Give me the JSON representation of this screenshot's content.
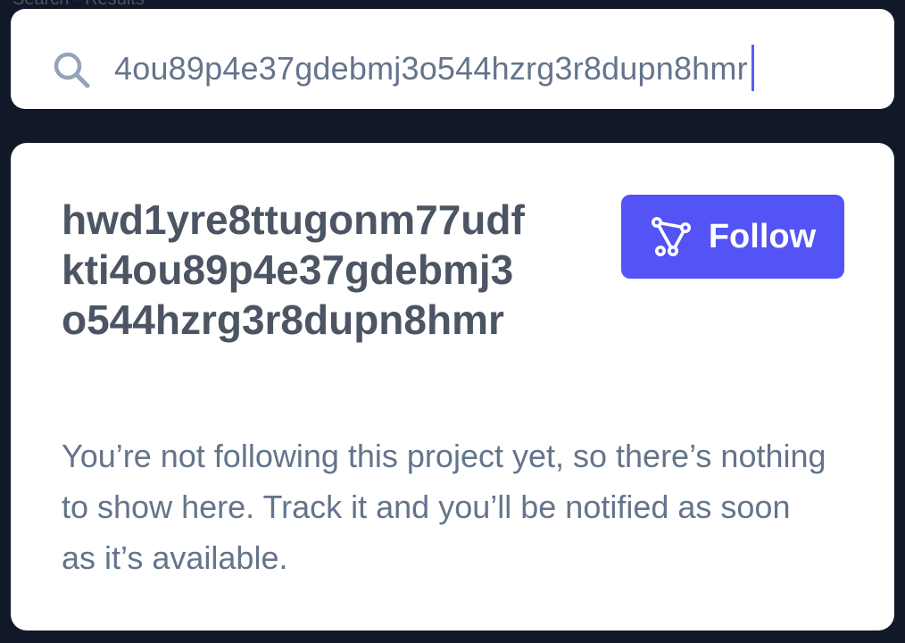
{
  "breadcrumb": "Search · Results",
  "search": {
    "query": "4ou89p4e37gdebmj3o544hzrg3r8dupn8hmr",
    "icon": "search-icon"
  },
  "project": {
    "title": "hwd1yre8ttugonm77udfkti4ou89p4e37gdebmj3o544hzrg3r8dupn8hmr",
    "follow_label": "Follow",
    "follow_icon": "track-graph-icon",
    "description": "You’re not following this project yet, so there’s nothing to show here. Track it and you’ll be notified as soon as it’s available."
  },
  "colors": {
    "background": "#111827",
    "accent": "#5353f6",
    "title_text": "#4b5563",
    "body_text": "#64748b",
    "caret": "#5b5bf5"
  }
}
